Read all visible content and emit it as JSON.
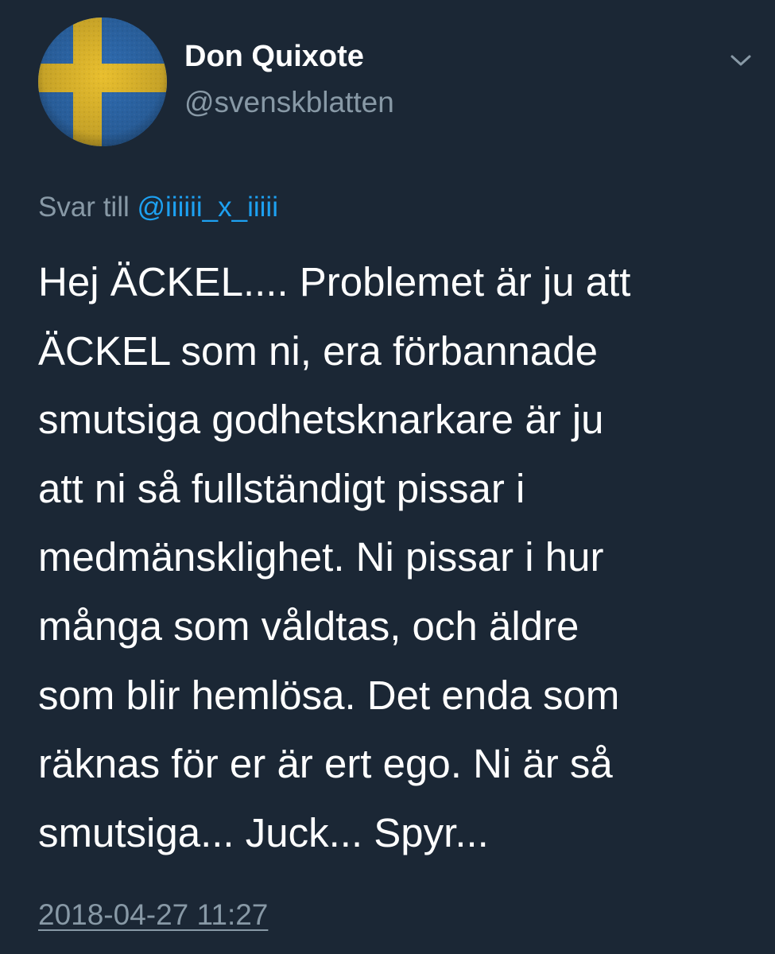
{
  "tweet": {
    "author": {
      "display_name": "Don Quixote",
      "handle": "@svenskblatten",
      "avatar_icon": "swedish-flag-avatar"
    },
    "menu_icon": "chevron-down-icon",
    "reply_to": {
      "prefix": "Svar till",
      "mention": "@iiiiii_x_iiiii"
    },
    "text_lines": [
      "Hej ÄCKEL.... Problemet är ju att",
      "ÄCKEL som ni, era förbannade",
      "smutsiga godhetsknarkare är ju",
      "att ni så fullständigt pissar i",
      "medmänsklighet. Ni pissar i hur",
      "många som våldtas, och äldre",
      "som blir hemlösa. Det enda som",
      "räknas för er är ert ego. Ni är så",
      "smutsiga... Juck... Spyr..."
    ],
    "timestamp": "2018-04-27 11:27"
  },
  "colors": {
    "background": "#1b2735",
    "primary_text": "#ffffff",
    "secondary_text": "#8899a6",
    "link": "#1da1f2",
    "flag_blue": "#2f6db3",
    "flag_yellow": "#e9bf2e"
  }
}
